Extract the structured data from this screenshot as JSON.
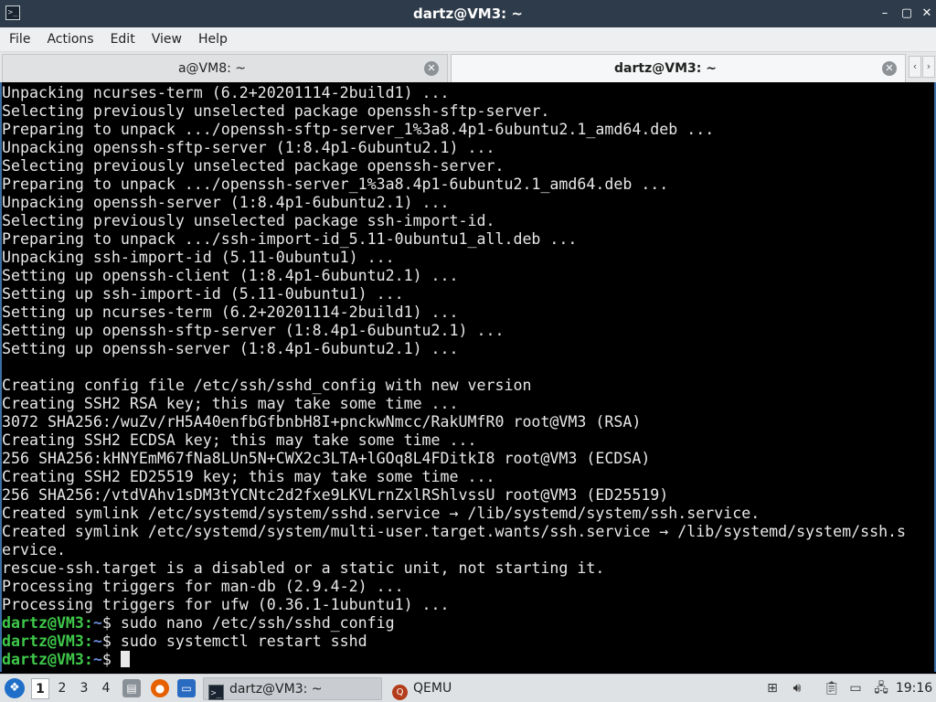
{
  "window": {
    "title": "dartz@VM3: ~",
    "app_icon": "terminal-icon",
    "controls": {
      "minimize": "minimize-icon",
      "maximize": "maximize-icon",
      "close": "close-icon"
    }
  },
  "menu": {
    "items": [
      "File",
      "Actions",
      "Edit",
      "View",
      "Help"
    ]
  },
  "tabs": [
    {
      "label": "a@VM8: ~",
      "active": false
    },
    {
      "label": "dartz@VM3: ~",
      "active": true
    }
  ],
  "tab_nav": {
    "left": "‹",
    "right": "›"
  },
  "terminal": {
    "output": [
      "Unpacking ncurses-term (6.2+20201114-2build1) ...",
      "Selecting previously unselected package openssh-sftp-server.",
      "Preparing to unpack .../openssh-sftp-server_1%3a8.4p1-6ubuntu2.1_amd64.deb ...",
      "Unpacking openssh-sftp-server (1:8.4p1-6ubuntu2.1) ...",
      "Selecting previously unselected package openssh-server.",
      "Preparing to unpack .../openssh-server_1%3a8.4p1-6ubuntu2.1_amd64.deb ...",
      "Unpacking openssh-server (1:8.4p1-6ubuntu2.1) ...",
      "Selecting previously unselected package ssh-import-id.",
      "Preparing to unpack .../ssh-import-id_5.11-0ubuntu1_all.deb ...",
      "Unpacking ssh-import-id (5.11-0ubuntu1) ...",
      "Setting up openssh-client (1:8.4p1-6ubuntu2.1) ...",
      "Setting up ssh-import-id (5.11-0ubuntu1) ...",
      "Setting up ncurses-term (6.2+20201114-2build1) ...",
      "Setting up openssh-sftp-server (1:8.4p1-6ubuntu2.1) ...",
      "Setting up openssh-server (1:8.4p1-6ubuntu2.1) ...",
      "",
      "Creating config file /etc/ssh/sshd_config with new version",
      "Creating SSH2 RSA key; this may take some time ...",
      "3072 SHA256:/wuZv/rH5A40enfbGfbnbH8I+pnckwNmcc/RakUMfR0 root@VM3 (RSA)",
      "Creating SSH2 ECDSA key; this may take some time ...",
      "256 SHA256:kHNYEmM67fNa8LUn5N+CWX2c3LTA+lGOq8L4FDitkI8 root@VM3 (ECDSA)",
      "Creating SSH2 ED25519 key; this may take some time ...",
      "256 SHA256:/vtdVAhv1sDM3tYCNtc2d2fxe9LKVLrnZxlRShlvssU root@VM3 (ED25519)",
      "Created symlink /etc/systemd/system/sshd.service → /lib/systemd/system/ssh.service.",
      "Created symlink /etc/systemd/system/multi-user.target.wants/ssh.service → /lib/systemd/system/ssh.s",
      "ervice.",
      "rescue-ssh.target is a disabled or a static unit, not starting it.",
      "Processing triggers for man-db (2.9.4-2) ...",
      "Processing triggers for ufw (0.36.1-1ubuntu1) ..."
    ],
    "prompts": [
      {
        "user": "dartz@VM3",
        "sep": ":",
        "path": "~",
        "symbol": "$ ",
        "command": "sudo nano /etc/ssh/sshd_config"
      },
      {
        "user": "dartz@VM3",
        "sep": ":",
        "path": "~",
        "symbol": "$ ",
        "command": "sudo systemctl restart sshd"
      },
      {
        "user": "dartz@VM3",
        "sep": ":",
        "path": "~",
        "symbol": "$ ",
        "command": ""
      }
    ],
    "colors": {
      "user": "#3ec84a",
      "path": "#6a8bd8",
      "text": "#e8e8e8",
      "background": "#000000"
    }
  },
  "taskbar": {
    "start_icon": "start-menu-icon",
    "workspaces": [
      "1",
      "2",
      "3",
      "4"
    ],
    "active_workspace": "1",
    "quick_launch": [
      "file-manager-icon",
      "firefox-icon",
      "show-desktop-icon"
    ],
    "tasks": [
      {
        "label": "dartz@VM3: ~",
        "icon": "terminal-icon",
        "active": true
      },
      {
        "label": "QEMU",
        "icon": "qemu-icon",
        "active": false
      }
    ],
    "tray": [
      "app-grid-icon",
      "volume-icon",
      "clipboard-icon",
      "battery-icon",
      "network-icon"
    ],
    "clock": "19:16"
  }
}
